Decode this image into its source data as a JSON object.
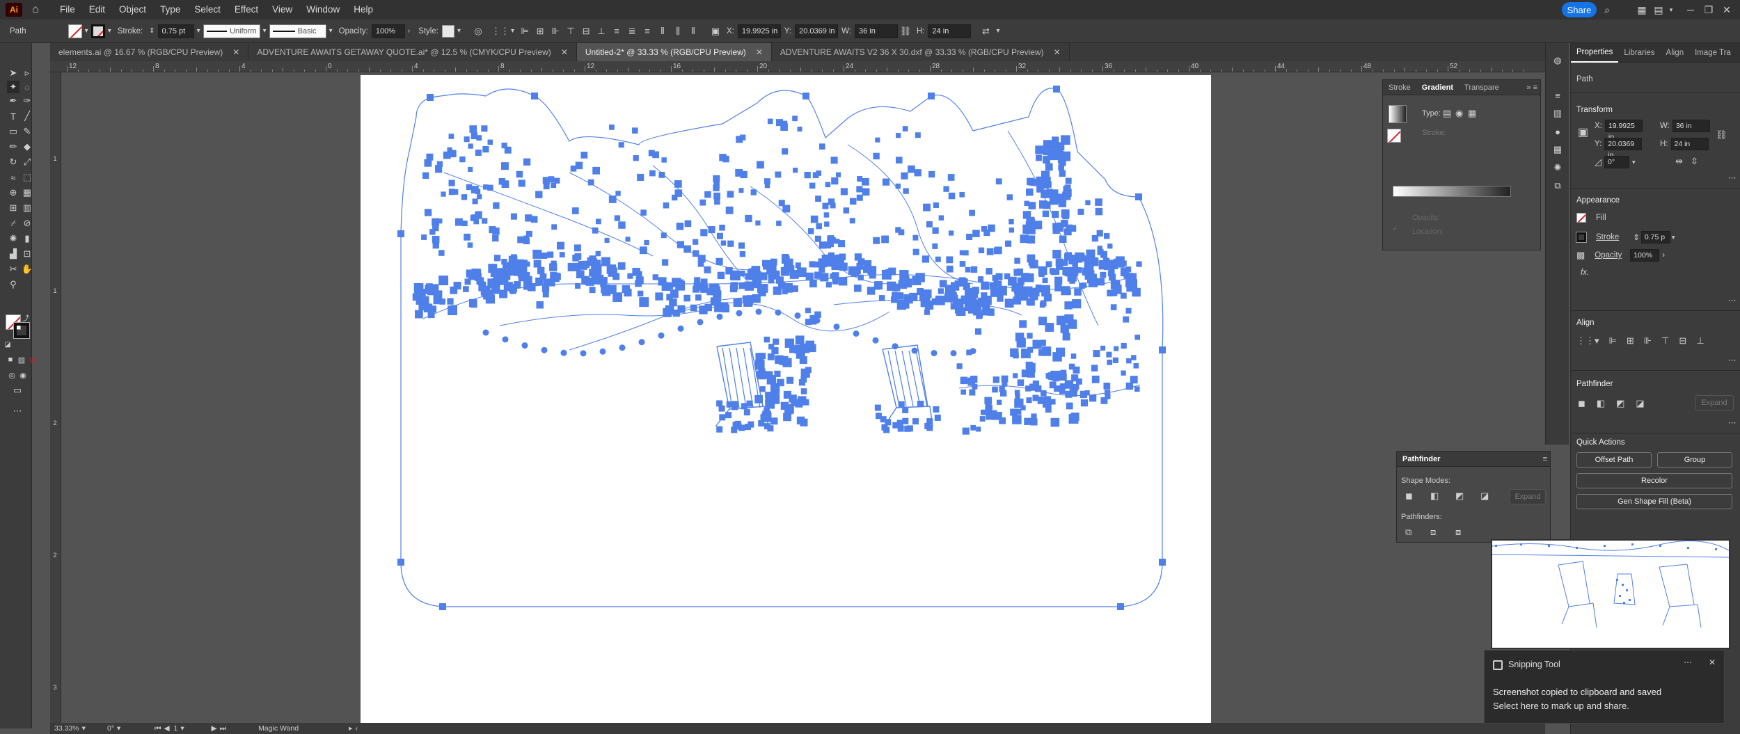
{
  "menubar": {
    "logo": "Ai",
    "items": [
      "File",
      "Edit",
      "Object",
      "Type",
      "Select",
      "Effect",
      "View",
      "Window",
      "Help"
    ],
    "share_label": "Share"
  },
  "controlbar": {
    "selection_type": "Path",
    "stroke_label": "Stroke:",
    "stroke_value": "0.75 pt",
    "stroke_profile": "Uniform",
    "brush": "Basic",
    "opacity_label": "Opacity:",
    "opacity_value": "100%",
    "style_label": "Style:",
    "x_label": "X:",
    "x_value": "19.9925 in",
    "y_label": "Y:",
    "y_value": "20.0369 in",
    "w_label": "W:",
    "w_value": "36 in",
    "h_label": "H:",
    "h_value": "24 in"
  },
  "tabs": [
    {
      "label": "elements.ai @ 16.67 % (RGB/CPU Preview)",
      "active": false
    },
    {
      "label": "ADVENTURE AWAITS GETAWAY QUOTE.ai* @ 12.5 % (CMYK/CPU Preview)",
      "active": false
    },
    {
      "label": "Untitled-2* @ 33.33 % (RGB/CPU Preview)",
      "active": true
    },
    {
      "label": "ADVENTURE AWAITS V2 36 X 30.dxf @ 33.33 % (RGB/CPU Preview)",
      "active": false
    }
  ],
  "ruler": {
    "h_labels": [
      "12",
      "8",
      "4",
      "0",
      "4",
      "8",
      "12",
      "16",
      "20",
      "24",
      "28",
      "32",
      "36",
      "40",
      "44",
      "48",
      "52"
    ],
    "v_labels": [
      "1",
      "1",
      "2",
      "2",
      "3"
    ]
  },
  "statusbar": {
    "zoom": "33.33%",
    "rotation": "0°",
    "artboard": "1",
    "tool": "Magic Wand"
  },
  "gradient_panel": {
    "tabs": [
      "Stroke",
      "Gradient",
      "Transpare"
    ],
    "type_label": "Type:",
    "stroke_label": "Stroke:",
    "opacity_label": "Opacity:",
    "location_label": "Location:"
  },
  "pathfinder_panel": {
    "title": "Pathfinder",
    "shape_modes_label": "Shape Modes:",
    "expand_label": "Expand",
    "pathfinders_label": "Pathfinders:"
  },
  "properties": {
    "tabs": [
      "Properties",
      "Libraries",
      "Align",
      "Image Tra"
    ],
    "selection": "Path",
    "transform_title": "Transform",
    "x_label": "X:",
    "x_value": "19.9925 in",
    "y_label": "Y:",
    "y_value": "20.0369 in",
    "w_label": "W:",
    "w_value": "36 in",
    "h_label": "H:",
    "h_value": "24 in",
    "rotate_value": "0°",
    "appearance_title": "Appearance",
    "fill_label": "Fill",
    "stroke_label": "Stroke",
    "stroke_value": "0.75 p",
    "opacity_label": "Opacity",
    "opacity_value": "100%",
    "fx_label": "fx.",
    "align_title": "Align",
    "pathfinder_title": "Pathfinder",
    "expand_label": "Expand",
    "quick_actions_title": "Quick Actions",
    "offset_path_label": "Offset Path",
    "group_label": "Group",
    "recolor_label": "Recolor",
    "gen_shape_fill_label": "Gen Shape Fill (Beta)"
  },
  "toast": {
    "app": "Snipping Tool",
    "line1": "Screenshot copied to clipboard and saved",
    "line2": "Select here to mark up and share."
  },
  "colors": {
    "accent": "#1473e6",
    "path_selection": "#4f7fe9",
    "canvas_bg": "#535353",
    "artboard": "#ffffff"
  }
}
